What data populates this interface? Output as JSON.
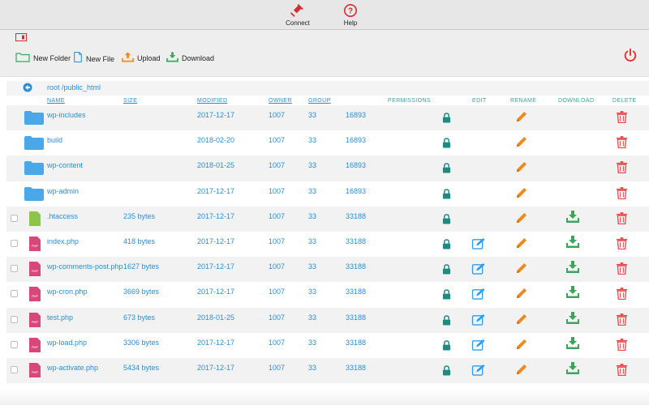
{
  "toolbar": {
    "connect_label": "Connect",
    "help_label": "Help"
  },
  "actions": {
    "new_folder": "New Folder",
    "new_file": "New File",
    "upload": "Upload",
    "download": "Download"
  },
  "path": "root /public_html",
  "columns": {
    "name": "NAME",
    "size": "SIZE",
    "modified": "MODIFIED",
    "owner": "OWNER",
    "group": "GROUP",
    "permissions": "PERMISSIONS",
    "edit": "EDIT",
    "rename": "RENAME",
    "download": "DOWNLOAD",
    "delete": "DELETE"
  },
  "files": [
    {
      "name": "wp-includes",
      "type": "folder",
      "size": "",
      "modified": "2017-12-17",
      "owner": "1007",
      "group": "33",
      "perm": "16893"
    },
    {
      "name": "build",
      "type": "folder",
      "size": "",
      "modified": "2018-02-20",
      "owner": "1007",
      "group": "33",
      "perm": "16893"
    },
    {
      "name": "wp-content",
      "type": "folder",
      "size": "",
      "modified": "2018-01-25",
      "owner": "1007",
      "group": "33",
      "perm": "16893"
    },
    {
      "name": "wp-admin",
      "type": "folder",
      "size": "",
      "modified": "2017-12-17",
      "owner": "1007",
      "group": "33",
      "perm": "16893"
    },
    {
      "name": ".htaccess",
      "type": "file",
      "size": "235 bytes",
      "modified": "2017-12-17",
      "owner": "1007",
      "group": "33",
      "perm": "33188"
    },
    {
      "name": "index.php",
      "type": "php",
      "size": "418 bytes",
      "modified": "2017-12-17",
      "owner": "1007",
      "group": "33",
      "perm": "33188"
    },
    {
      "name": "wp-comments-post.php",
      "type": "php",
      "size": "1627 bytes",
      "modified": "2017-12-17",
      "owner": "1007",
      "group": "33",
      "perm": "33188"
    },
    {
      "name": "wp-cron.php",
      "type": "php",
      "size": "3669 bytes",
      "modified": "2017-12-17",
      "owner": "1007",
      "group": "33",
      "perm": "33188"
    },
    {
      "name": "test.php",
      "type": "php",
      "size": "673 bytes",
      "modified": "2018-01-25",
      "owner": "1007",
      "group": "33",
      "perm": "33188"
    },
    {
      "name": "wp-load.php",
      "type": "php",
      "size": "3306 bytes",
      "modified": "2017-12-17",
      "owner": "1007",
      "group": "33",
      "perm": "33188"
    },
    {
      "name": "wp-activate.php",
      "type": "php",
      "size": "5434 bytes",
      "modified": "2017-12-17",
      "owner": "1007",
      "group": "33",
      "perm": "33188"
    }
  ],
  "colors": {
    "accent_blue": "#2b8fd8",
    "lock_teal": "#1f8a80",
    "edit_blue": "#2a9df4",
    "rename_orange": "#f08a1c",
    "download_green": "#3ba55c",
    "delete_red": "#e8474c",
    "folder_blue": "#4aa8e8",
    "php_pink": "#d9477a",
    "file_green": "#8cc54a"
  },
  "icons": {
    "connect": "plug-icon",
    "help": "question-circle-icon",
    "power": "power-icon",
    "back": "arrow-circle-left-icon"
  }
}
